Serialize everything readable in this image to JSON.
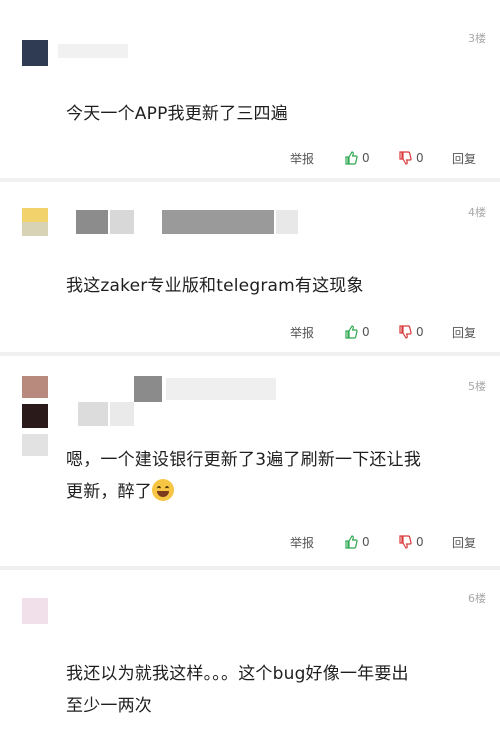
{
  "comments": [
    {
      "floor": "3楼",
      "text": "今天一个APP我更新了三四遍",
      "actions": {
        "report": "举报",
        "likes": "0",
        "dislikes": "0",
        "reply": "回复"
      }
    },
    {
      "floor": "4楼",
      "text": "我这zaker专业版和telegram有这现象",
      "actions": {
        "report": "举报",
        "likes": "0",
        "dislikes": "0",
        "reply": "回复"
      }
    },
    {
      "floor": "5楼",
      "text_line1": "嗯，一个建设银行更新了3遍了刷新一下还让我",
      "text_line2": "更新，醉了",
      "actions": {
        "report": "举报",
        "likes": "0",
        "dislikes": "0",
        "reply": "回复"
      }
    },
    {
      "floor": "6楼",
      "text_line1": "我还以为就我这样。。。这个bug好像一年要出",
      "text_line2": "至少一两次"
    }
  ],
  "colors": {
    "accent_like": "#2fa84f",
    "accent_dislike": "#d93a3a",
    "separator": "#f0f0f0"
  }
}
